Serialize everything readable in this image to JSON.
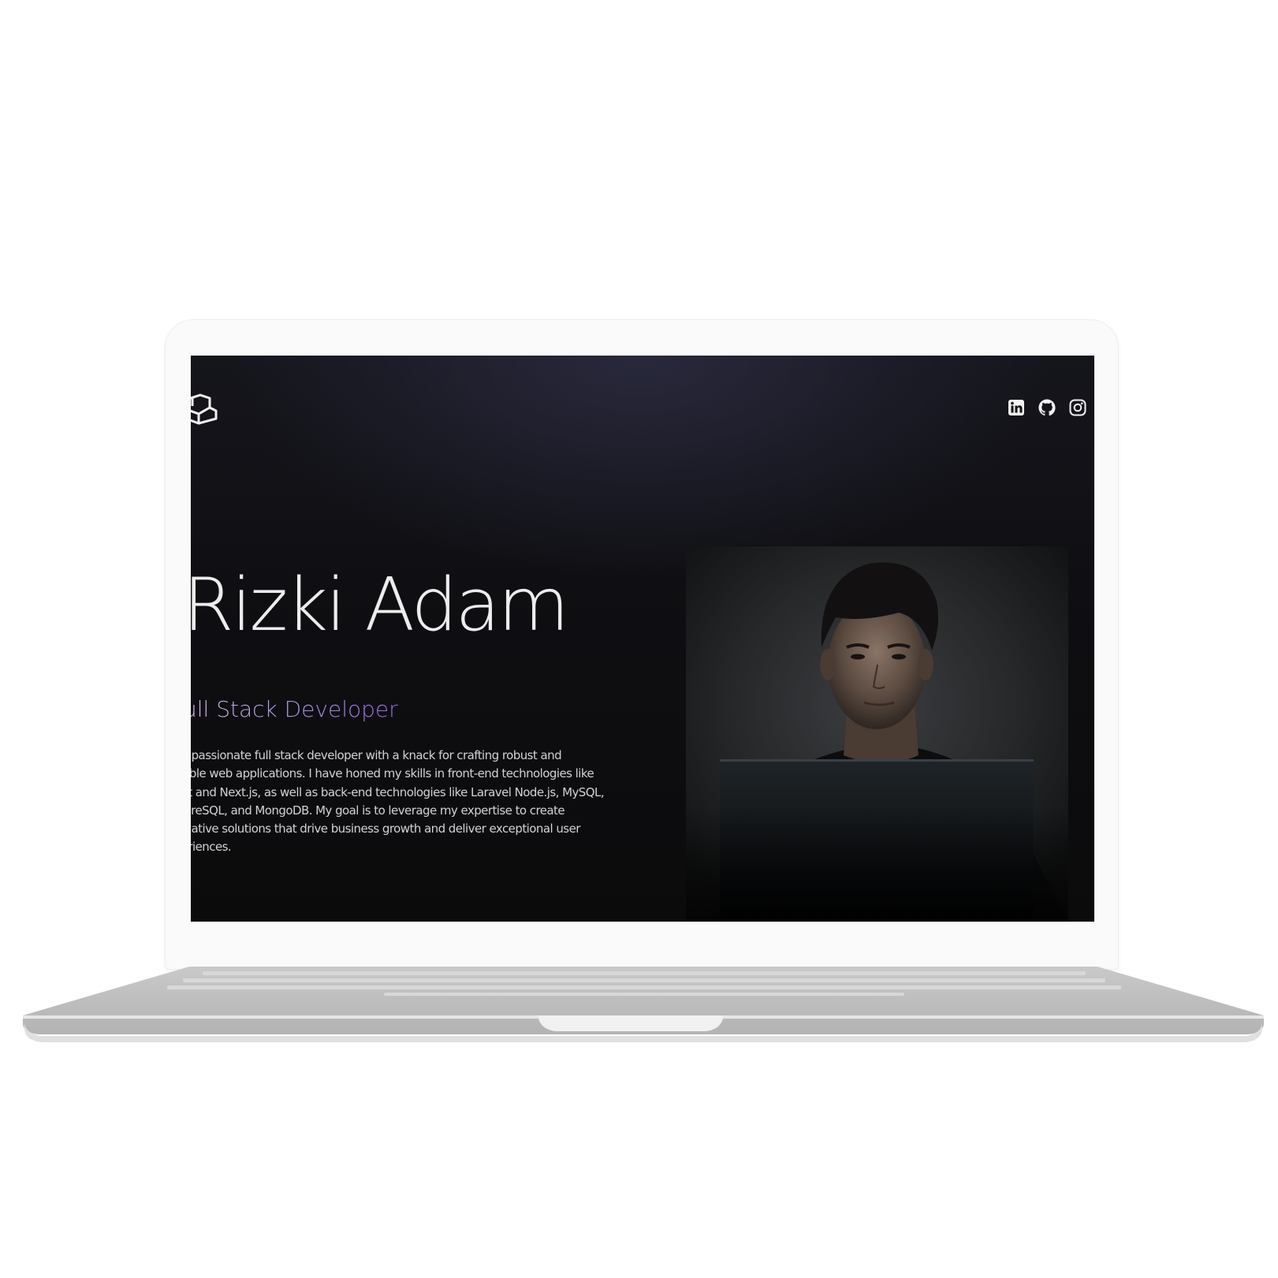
{
  "hero": {
    "name": "Rizki Adam",
    "role": "ull Stack Developer",
    "bio_lines": [
      "I'm a passionate full stack developer with a knack for crafting robust and",
      "scalable web applications. I have honed my skills in front-end technologies like",
      "React and Next.js, as well as back-end technologies like Laravel Node.js, MySQL,",
      "PostgreSQL, and MongoDB. My goal is to leverage my expertise to create",
      "innovative solutions that drive business growth and deliver exceptional user",
      "experiences."
    ]
  },
  "header": {
    "logo_icon": "cube-logo-icon",
    "social_icons": [
      "linkedin-icon",
      "github-icon",
      "instagram-icon"
    ]
  },
  "portrait": {
    "subject": "portrait-photo"
  },
  "colors": {
    "page_background": "#ffffff",
    "laptop_shell": "#fafafa",
    "laptop_base": "#b5b5b5",
    "screen_background": "#0d0d10",
    "name_text": "#ececec",
    "role_gradient_start": "#d7b7e3",
    "role_gradient_end": "#9a6ae0",
    "bio_text": "#d2d2d2",
    "icon": "#f2f2f2"
  }
}
